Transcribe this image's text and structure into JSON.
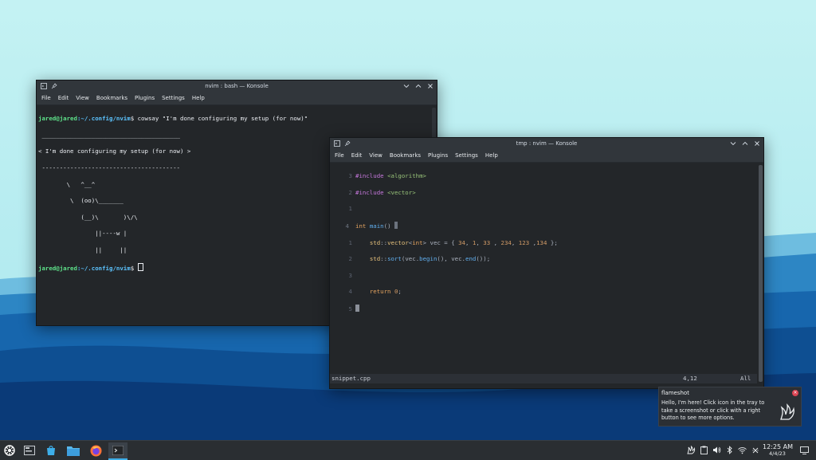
{
  "windows": {
    "bash": {
      "title": "nvim : bash — Konsole",
      "menu": [
        "File",
        "Edit",
        "View",
        "Bookmarks",
        "Plugins",
        "Settings",
        "Help"
      ],
      "user_host": "jared@jared",
      "path": ":~/.config/nvim",
      "command": "$ cowsay \"I'm done configuring my setup (for now)\"",
      "cow_lines": [
        " _______________________________________",
        "< I'm done configuring my setup (for now) >",
        " ---------------------------------------",
        "        \\   ^__^",
        "         \\  (oo)\\_______",
        "            (__)\\       )\\/\\",
        "                ||----w |",
        "                ||     ||"
      ],
      "prompt_end": "$ "
    },
    "nvim": {
      "title": "tmp : nvim — Konsole",
      "menu": [
        "File",
        "Edit",
        "View",
        "Bookmarks",
        "Plugins",
        "Settings",
        "Help"
      ],
      "line_numbers": [
        "3",
        "2",
        "1",
        "4",
        "1",
        "2",
        "3",
        "4",
        "5"
      ],
      "code": {
        "inc1_kw": "#include",
        "inc1_hdr": "<algorithm>",
        "inc2_kw": "#include",
        "inc2_hdr": "<vector>",
        "int_kw": "int",
        "main_fn": "main",
        "main_paren": "() ",
        "open_brace": "{",
        "std1": "std",
        "colons1": "::",
        "vector_t": "vector",
        "lt": "<",
        "int_t": "int",
        "gt": ">",
        "vec_decl": " vec = { ",
        "n1": "34",
        "c1": ", ",
        "n2": "1",
        "c2": ", ",
        "n3": "33",
        "c3": " , ",
        "n4": "234",
        "c4": ", ",
        "n5": "123",
        "c5": " ,",
        "n6": "134",
        "close1": " };",
        "std2": "std",
        "colons2": "::",
        "sort_fn": "sort",
        "sort_open": "(vec.",
        "begin_fn": "begin",
        "begin_rest": "(), vec.",
        "end_fn": "end",
        "end_rest": "());",
        "return_kw": "return",
        "ret_val_num": "0",
        "semicolon": ";"
      },
      "status_file": "snippet.cpp",
      "status_pos": "4,12",
      "status_all": "All"
    }
  },
  "notification": {
    "app": "flameshot",
    "body": "Hello, I'm here! Click icon in the tray to take a screenshot or click with a right button to see more options.",
    "icon": "flameshot-icon"
  },
  "taskbar": {
    "items": [
      "app-launcher-icon",
      "window-switcher-icon",
      "discover-store-icon",
      "file-manager-icon",
      "firefox-icon",
      "konsole-icon"
    ],
    "tray": [
      "flameshot-tray-icon",
      "clipboard-icon",
      "volume-icon",
      "bluetooth-icon",
      "wifi-icon",
      "notifications-icon"
    ],
    "time": "12:25 AM",
    "date": "4/4/23"
  },
  "colors": {
    "sky": "#b8eef0",
    "mountains": "#0c4f92",
    "prompt_green": "#5ee28a",
    "path_blue": "#5cc4ff"
  }
}
